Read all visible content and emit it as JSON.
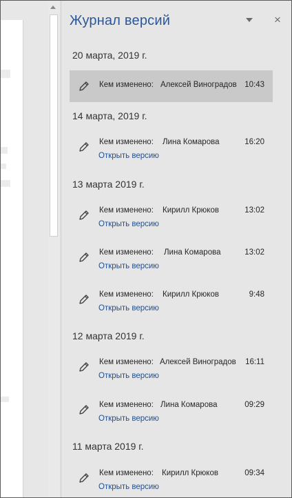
{
  "panel": {
    "title": "Журнал версий",
    "menu_icon": "dropdown-triangle-icon",
    "close_label": "×"
  },
  "by_label": "Кем изменено:",
  "open_label": "Открыть версию",
  "groups": [
    {
      "date": "20 марта, 2019 г.",
      "entries": [
        {
          "name": "Алексей Виноградов",
          "time": "10:43",
          "selected": true
        }
      ]
    },
    {
      "date": "14 марта, 2019 г.",
      "entries": [
        {
          "name": "Лина Комарова",
          "time": "16:20"
        }
      ]
    },
    {
      "date": "13 марта 2019 г.",
      "entries": [
        {
          "name": "Кирилл Крюков",
          "time": "13:02"
        },
        {
          "name": "Лина Комарова",
          "time": "13:02"
        },
        {
          "name": "Кирилл Крюков",
          "time": "9:48"
        }
      ]
    },
    {
      "date": "12 марта 2019 г.",
      "entries": [
        {
          "name": "Алексей Виноградов",
          "time": "16:11"
        },
        {
          "name": "Лина Комарова",
          "time": "09:29"
        }
      ]
    },
    {
      "date": "11 марта 2019 г.",
      "entries": [
        {
          "name": "Кирилл Крюков",
          "time": "09:34"
        }
      ]
    }
  ]
}
